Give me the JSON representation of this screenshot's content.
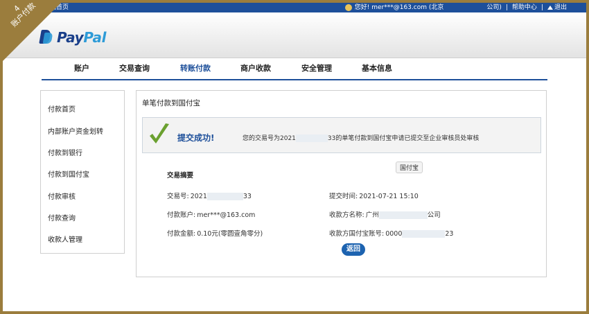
{
  "corner_badge": {
    "number": "4",
    "label": "账户付款"
  },
  "topbar": {
    "home": "回首页",
    "greeting": "您好! mer***@163.com (北京",
    "company_suffix": "公司)",
    "help": "帮助中心",
    "logout": "退出",
    "sep": "|"
  },
  "logo": {
    "pay": "Pay",
    "pal": "Pal"
  },
  "nav": {
    "tabs": [
      {
        "label": "账户"
      },
      {
        "label": "交易查询"
      },
      {
        "label": "转账付款"
      },
      {
        "label": "商户收款"
      },
      {
        "label": "安全管理"
      },
      {
        "label": "基本信息"
      }
    ],
    "active": "转账付款"
  },
  "sidebar": {
    "items": [
      {
        "label": "付款首页"
      },
      {
        "label": "内部账户资金划转"
      },
      {
        "label": "付款到银行"
      },
      {
        "label": "付款到国付宝"
      },
      {
        "label": "付款审核"
      },
      {
        "label": "付款查询"
      },
      {
        "label": "收款人管理"
      }
    ]
  },
  "main": {
    "title": "单笔付款到国付宝",
    "success_title": "提交成功!",
    "success_msg_prefix": "您的交易号为2021",
    "success_msg_suffix": "33的单笔付款到国付宝申请已提交至企业审核员处审核",
    "tooltip": "国付宝",
    "summary_title": "交易摘要",
    "fields": {
      "trade_no_label": "交易号:",
      "trade_no_prefix": "2021",
      "trade_no_suffix": "33",
      "submit_time_label": "提交时间:",
      "submit_time": "2021-07-21 15:10",
      "payer_label": "付款账户:",
      "payer": "mer***@163.com",
      "payee_name_label": "收款方名称:",
      "payee_name_prefix": "广州",
      "payee_name_suffix": "公司",
      "amount_label": "付款金额:",
      "amount": "0.10元(零圆壹角零分)",
      "payee_acct_label": "收款方国付宝账号:",
      "payee_acct_prefix": "0000",
      "payee_acct_suffix": "23"
    },
    "back_button": "返回"
  },
  "colors": {
    "primary": "#1d4f9a",
    "accent": "#2e9bd7",
    "frame": "#9b7d3d",
    "check": "#6aa02f"
  }
}
